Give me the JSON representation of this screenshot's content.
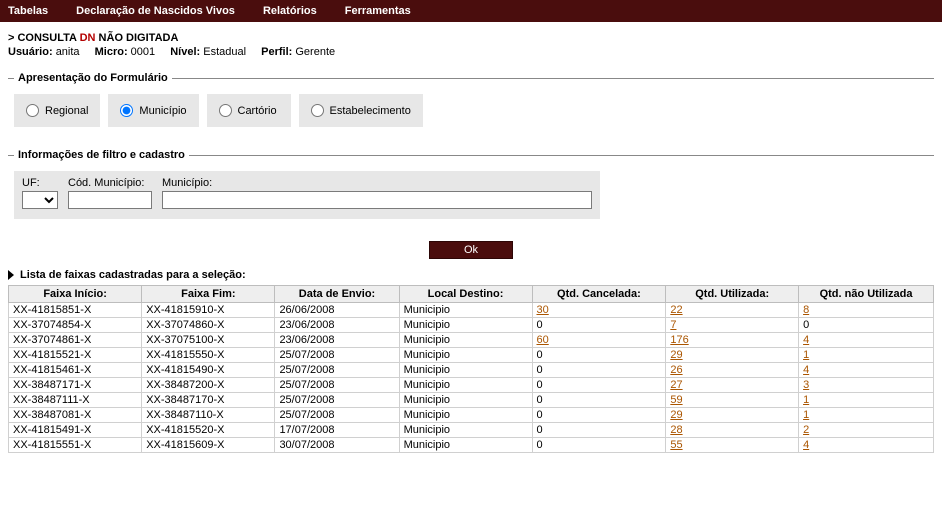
{
  "menu": {
    "tabelas": "Tabelas",
    "dnvivos": "Declaração de Nascidos Vivos",
    "relatorios": "Relatórios",
    "ferramentas": "Ferramentas"
  },
  "title": {
    "prefix": "> CONSULTA ",
    "dn": "DN",
    "suffix": " NÃO DIGITADA"
  },
  "info": {
    "usuario_label": "Usuário:",
    "usuario_value": "anita",
    "micro_label": "Micro:",
    "micro_value": "0001",
    "nivel_label": "Nível:",
    "nivel_value": "Estadual",
    "perfil_label": "Perfil:",
    "perfil_value": "Gerente"
  },
  "fieldset1": {
    "legend": "Apresentação do Formulário",
    "opts": {
      "regional": "Regional",
      "municipio": "Município",
      "cartorio": "Cartório",
      "estabelecimento": "Estabelecimento"
    },
    "selected": "municipio"
  },
  "fieldset2": {
    "legend": "Informações de filtro e cadastro",
    "uf_label": "UF:",
    "codmun_label": "Cód. Município:",
    "mun_label": "Município:",
    "uf_value": "",
    "codmun_value": "",
    "mun_value": ""
  },
  "ok_label": "Ok",
  "list_header": "Lista de faixas cadastradas para a seleção:",
  "columns": {
    "faixa_inicio": "Faixa Início:",
    "faixa_fim": "Faixa Fim:",
    "data_envio": "Data de Envio:",
    "local": "Local Destino:",
    "cancel": "Qtd. Cancelada:",
    "util": "Qtd. Utilizada:",
    "naoutil": "Qtd. não Utilizada"
  },
  "rows": [
    {
      "ini": "XX-41815851-X",
      "fim": "XX-41815910-X",
      "data": "26/06/2008",
      "local": "Municipio",
      "cancel": "30",
      "cancel_link": true,
      "util": "22",
      "util_link": true,
      "nao": "8",
      "nao_link": true
    },
    {
      "ini": "XX-37074854-X",
      "fim": "XX-37074860-X",
      "data": "23/06/2008",
      "local": "Municipio",
      "cancel": "0",
      "cancel_link": false,
      "util": "7",
      "util_link": true,
      "nao": "0",
      "nao_link": false
    },
    {
      "ini": "XX-37074861-X",
      "fim": "XX-37075100-X",
      "data": "23/06/2008",
      "local": "Municipio",
      "cancel": "60",
      "cancel_link": true,
      "util": "176",
      "util_link": true,
      "nao": "4",
      "nao_link": true
    },
    {
      "ini": "XX-41815521-X",
      "fim": "XX-41815550-X",
      "data": "25/07/2008",
      "local": "Municipio",
      "cancel": "0",
      "cancel_link": false,
      "util": "29",
      "util_link": true,
      "nao": "1",
      "nao_link": true
    },
    {
      "ini": "XX-41815461-X",
      "fim": "XX-41815490-X",
      "data": "25/07/2008",
      "local": "Municipio",
      "cancel": "0",
      "cancel_link": false,
      "util": "26",
      "util_link": true,
      "nao": "4",
      "nao_link": true
    },
    {
      "ini": "XX-38487171-X",
      "fim": "XX-38487200-X",
      "data": "25/07/2008",
      "local": "Municipio",
      "cancel": "0",
      "cancel_link": false,
      "util": "27",
      "util_link": true,
      "nao": "3",
      "nao_link": true
    },
    {
      "ini": "XX-38487111-X",
      "fim": "XX-38487170-X",
      "data": "25/07/2008",
      "local": "Municipio",
      "cancel": "0",
      "cancel_link": false,
      "util": "59",
      "util_link": true,
      "nao": "1",
      "nao_link": true
    },
    {
      "ini": "XX-38487081-X",
      "fim": "XX-38487110-X",
      "data": "25/07/2008",
      "local": "Municipio",
      "cancel": "0",
      "cancel_link": false,
      "util": "29",
      "util_link": true,
      "nao": "1",
      "nao_link": true
    },
    {
      "ini": "XX-41815491-X",
      "fim": "XX-41815520-X",
      "data": "17/07/2008",
      "local": "Municipio",
      "cancel": "0",
      "cancel_link": false,
      "util": "28",
      "util_link": true,
      "nao": "2",
      "nao_link": true
    },
    {
      "ini": "XX-41815551-X",
      "fim": "XX-41815609-X",
      "data": "30/07/2008",
      "local": "Municipio",
      "cancel": "0",
      "cancel_link": false,
      "util": "55",
      "util_link": true,
      "nao": "4",
      "nao_link": true
    }
  ]
}
